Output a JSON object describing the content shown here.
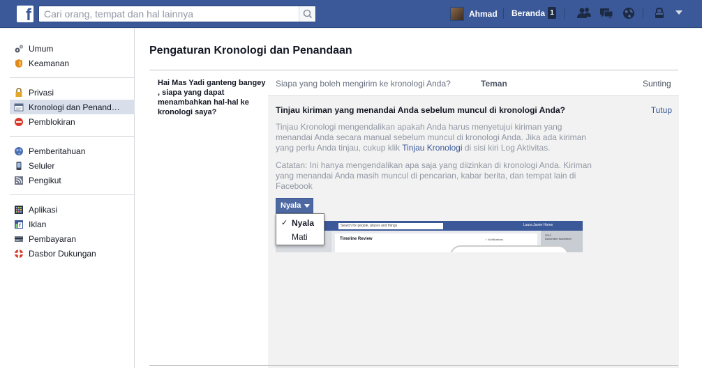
{
  "header": {
    "search_placeholder": "Cari orang, tempat dan hal lainnya",
    "user_name": "Ahmad",
    "home_label": "Beranda",
    "home_badge": "1",
    "icons": [
      "friends-icon",
      "messages-icon",
      "notifications-globe-icon",
      "privacy-lock-icon",
      "account-caret-icon"
    ]
  },
  "sidebar": {
    "groups": [
      [
        {
          "label": "Umum",
          "icon": "gears-icon"
        },
        {
          "label": "Keamanan",
          "icon": "shield-icon"
        }
      ],
      [
        {
          "label": "Privasi",
          "icon": "lock-icon"
        },
        {
          "label": "Kronologi dan Penand…",
          "icon": "timeline-icon",
          "active": true
        },
        {
          "label": "Pemblokiran",
          "icon": "block-icon"
        }
      ],
      [
        {
          "label": "Pemberitahuan",
          "icon": "globe-icon"
        },
        {
          "label": "Seluler",
          "icon": "mobile-icon"
        },
        {
          "label": "Pengikut",
          "icon": "rss-icon"
        }
      ],
      [
        {
          "label": "Aplikasi",
          "icon": "apps-icon"
        },
        {
          "label": "Iklan",
          "icon": "ads-icon"
        },
        {
          "label": "Pembayaran",
          "icon": "payment-icon"
        },
        {
          "label": "Dasbor Dukungan",
          "icon": "lifebuoy-icon"
        }
      ]
    ]
  },
  "page": {
    "title": "Pengaturan Kronologi dan Penandaan",
    "question": "Hai Mas Yadi ganteng bangey , siapa yang dapat menambahkan hal-hal ke kronologi saya?",
    "row_question": "Siapa yang boleh mengirim ke kronologi Anda?",
    "row_value": "Teman",
    "row_edit": "Sunting"
  },
  "panel": {
    "heading": "Tinjau kiriman yang menandai Anda sebelum muncul di kronologi Anda?",
    "close": "Tutup",
    "desc_before": "Tinjau Kronologi mengendalikan apakah Anda harus menyetujui kiriman yang menandai Anda secara manual sebelum muncul di kronologi Anda. Jika ada kiriman yang perlu Anda tinjau, cukup klik ",
    "desc_link": "Tinjau Kronologi",
    "desc_after": " di sisi kiri Log Aktivitas.",
    "note": "Catatan: Ini hanya mengendalikan apa saja yang diizinkan di kronologi Anda. Kiriman yang menandai Anda masih muncul di pencarian, kabar berita, dan tempat lain di Facebook",
    "select_value": "Nyala",
    "options": [
      "Nyala",
      "Mati"
    ],
    "selected_option": "Nyala"
  },
  "preview": {
    "search_text": "Search for people, places and things",
    "user_text": "Laura Javier  Home",
    "title": "Timeline Review",
    "notif": "✓ Notifications",
    "year": "2012",
    "months": "December November"
  },
  "colors": {
    "brand": "#3b5998",
    "active_bg": "#d8dfea"
  }
}
